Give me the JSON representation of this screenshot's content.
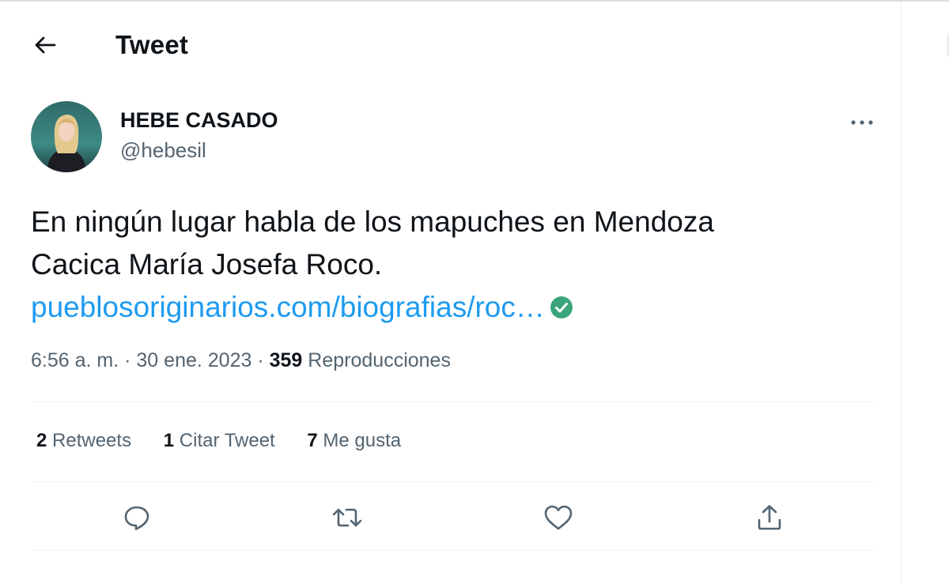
{
  "header": {
    "back_icon": "arrow-left-icon",
    "title": "Tweet"
  },
  "author": {
    "display_name": "HEBE CASADO",
    "handle": "@hebesil",
    "more_icon": "more-horizontal-icon"
  },
  "tweet": {
    "line1": "En ningún lugar habla de los mapuches en Mendoza",
    "line2": "Cacica María Josefa Roco.",
    "link_text": "pueblosoriginarios.com/biografias/roc…",
    "link_badge_icon": "check-circle-icon",
    "link_badge_color": "#3aa57a"
  },
  "meta": {
    "time": "6:56 a. m.",
    "separator": "·",
    "date": "30 ene. 2023",
    "views_count": "359",
    "views_label": "Reproducciones"
  },
  "stats": {
    "retweets_count": "2",
    "retweets_label": "Retweets",
    "quotes_count": "1",
    "quotes_label": "Citar Tweet",
    "likes_count": "7",
    "likes_label": "Me gusta"
  },
  "actions": [
    {
      "name": "reply",
      "icon": "reply-icon"
    },
    {
      "name": "retweet",
      "icon": "retweet-icon"
    },
    {
      "name": "like",
      "icon": "heart-icon"
    },
    {
      "name": "share",
      "icon": "share-icon"
    }
  ],
  "colors": {
    "text": "#0f1419",
    "secondary": "#536471",
    "link": "#1d9bf0",
    "divider": "#eff3f4"
  }
}
